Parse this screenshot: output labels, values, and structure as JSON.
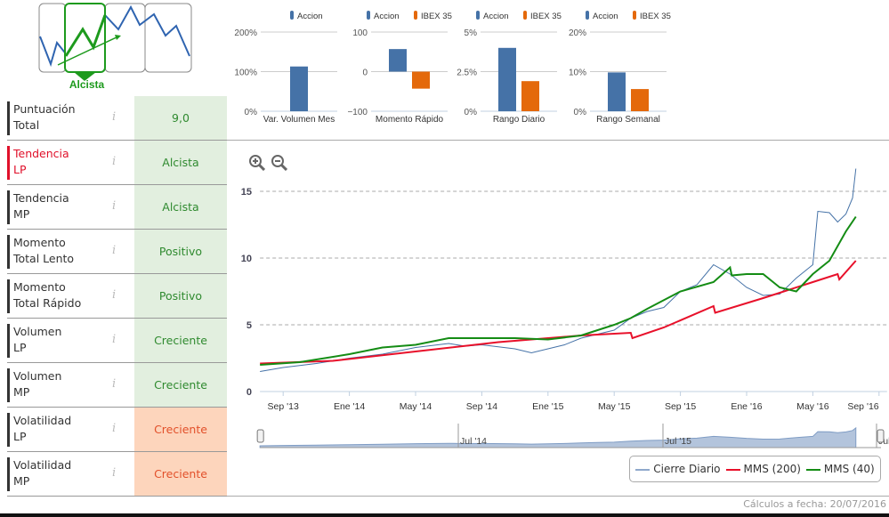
{
  "trend_logo": {
    "label": "Alcista"
  },
  "indicators": [
    {
      "label_l1": "Puntuación",
      "label_l2": "Total",
      "value": "9,0",
      "status": "positive",
      "highlight": false
    },
    {
      "label_l1": "Tendencia",
      "label_l2": "LP",
      "value": "Alcista",
      "status": "positive",
      "highlight": true
    },
    {
      "label_l1": "Tendencia",
      "label_l2": "MP",
      "value": "Alcista",
      "status": "positive",
      "highlight": false
    },
    {
      "label_l1": "Momento",
      "label_l2": "Total Lento",
      "value": "Positivo",
      "status": "positive",
      "highlight": false
    },
    {
      "label_l1": "Momento",
      "label_l2": "Total Rápido",
      "value": "Positivo",
      "status": "positive",
      "highlight": false
    },
    {
      "label_l1": "Volumen",
      "label_l2": "LP",
      "value": "Creciente",
      "status": "positive",
      "highlight": false
    },
    {
      "label_l1": "Volumen",
      "label_l2": "MP",
      "value": "Creciente",
      "status": "positive",
      "highlight": false
    },
    {
      "label_l1": "Volatilidad",
      "label_l2": "LP",
      "value": "Creciente",
      "status": "negative",
      "highlight": false
    },
    {
      "label_l1": "Volatilidad",
      "label_l2": "MP",
      "value": "Creciente",
      "status": "negative",
      "highlight": false
    }
  ],
  "info_glyph": "i",
  "colors": {
    "accion": "#4572a7",
    "ibex": "#e4690b",
    "cierre": "#4572a7",
    "mms200": "#e8102a",
    "mms40": "#148c14",
    "pos_bg": "#e2efdf",
    "neg_bg": "#fdd5bc"
  },
  "chart_data": [
    {
      "type": "bar",
      "title": "Var. Volumen Mes",
      "legend": [
        "Accion"
      ],
      "ticks": [
        "200%",
        "100%",
        "0%"
      ],
      "ylim": [
        0,
        200
      ],
      "series": [
        {
          "name": "Accion",
          "values": [
            113
          ]
        }
      ]
    },
    {
      "type": "bar",
      "title": "Momento Rápido",
      "legend": [
        "Accion",
        "IBEX 35"
      ],
      "ticks": [
        "100",
        "0",
        "−100"
      ],
      "ylim": [
        -100,
        100
      ],
      "series": [
        {
          "name": "Accion",
          "values": [
            57
          ]
        },
        {
          "name": "IBEX 35",
          "values": [
            -43
          ]
        }
      ]
    },
    {
      "type": "bar",
      "title": "Rango Diario",
      "legend": [
        "Accion",
        "IBEX 35"
      ],
      "ticks": [
        "5%",
        "2.5%",
        "0%"
      ],
      "ylim": [
        0,
        5
      ],
      "series": [
        {
          "name": "Accion",
          "values": [
            4.0
          ]
        },
        {
          "name": "IBEX 35",
          "values": [
            1.9
          ]
        }
      ]
    },
    {
      "type": "bar",
      "title": "Rango Semanal",
      "legend": [
        "Accion",
        "IBEX 35"
      ],
      "ticks": [
        "20%",
        "10%",
        "0%"
      ],
      "ylim": [
        0,
        20
      ],
      "series": [
        {
          "name": "Accion",
          "values": [
            9.8
          ]
        },
        {
          "name": "IBEX 35",
          "values": [
            5.6
          ]
        }
      ]
    },
    {
      "type": "line",
      "title": "",
      "x_unit": "months since Jul 2013",
      "xlim": [
        0.6,
        36.6
      ],
      "ylim": [
        0,
        17
      ],
      "y_ticks": [
        "0",
        "5",
        "10",
        "15"
      ],
      "y_tick_values": [
        0,
        5,
        10,
        15
      ],
      "x_ticks": [
        "Sep '13",
        "Ene '14",
        "May '14",
        "Sep '14",
        "Ene '15",
        "May '15",
        "Sep '15",
        "Ene '16",
        "May '16",
        "Sep '16"
      ],
      "x_tick_values": [
        2,
        6,
        10,
        14,
        18,
        22,
        26,
        30,
        34,
        38
      ],
      "navigator_labels": [
        "Jul '14",
        "Jul '15",
        "Jul"
      ],
      "navigator_values": [
        12,
        24,
        36
      ],
      "series": [
        {
          "name": "Cierre Diario",
          "points": [
            [
              0.6,
              1.5
            ],
            [
              2,
              1.8
            ],
            [
              4,
              2.1
            ],
            [
              6,
              2.5
            ],
            [
              8,
              2.8
            ],
            [
              10,
              3.3
            ],
            [
              12,
              3.6
            ],
            [
              13,
              3.4
            ],
            [
              14,
              3.5
            ],
            [
              16,
              3.2
            ],
            [
              17,
              2.9
            ],
            [
              18,
              3.2
            ],
            [
              19,
              3.5
            ],
            [
              20,
              4.0
            ],
            [
              21,
              4.3
            ],
            [
              22,
              4.6
            ],
            [
              23,
              5.5
            ],
            [
              24,
              6.0
            ],
            [
              25,
              6.3
            ],
            [
              26,
              7.5
            ],
            [
              27,
              8.0
            ],
            [
              28,
              9.5
            ],
            [
              29,
              8.8
            ],
            [
              30,
              7.8
            ],
            [
              31,
              7.2
            ],
            [
              32,
              7.3
            ],
            [
              33,
              8.5
            ],
            [
              34,
              9.5
            ],
            [
              34.3,
              13.5
            ],
            [
              35,
              13.4
            ],
            [
              35.5,
              12.7
            ],
            [
              36,
              13.3
            ],
            [
              36.4,
              14.5
            ],
            [
              36.6,
              16.7
            ]
          ]
        },
        {
          "name": "MMS (200)",
          "points": [
            [
              0.6,
              2.1
            ],
            [
              5,
              2.3
            ],
            [
              10,
              3.0
            ],
            [
              15,
              3.7
            ],
            [
              20,
              4.2
            ],
            [
              23,
              4.4
            ],
            [
              23.1,
              4.0
            ],
            [
              25,
              4.8
            ],
            [
              28,
              6.4
            ],
            [
              28.1,
              5.9
            ],
            [
              31,
              7.0
            ],
            [
              34,
              8.2
            ],
            [
              35.5,
              8.8
            ],
            [
              35.6,
              8.4
            ],
            [
              36.6,
              9.8
            ]
          ]
        },
        {
          "name": "MMS (40)",
          "points": [
            [
              0.6,
              2.0
            ],
            [
              3,
              2.2
            ],
            [
              6,
              2.8
            ],
            [
              8,
              3.3
            ],
            [
              10,
              3.5
            ],
            [
              12,
              4.0
            ],
            [
              14,
              4.0
            ],
            [
              16,
              4.0
            ],
            [
              18,
              3.9
            ],
            [
              20,
              4.2
            ],
            [
              22,
              5.0
            ],
            [
              23,
              5.5
            ],
            [
              24,
              6.2
            ],
            [
              26,
              7.5
            ],
            [
              28,
              8.2
            ],
            [
              29,
              9.3
            ],
            [
              29.1,
              8.7
            ],
            [
              30,
              8.8
            ],
            [
              31,
              8.8
            ],
            [
              32,
              7.8
            ],
            [
              33,
              7.5
            ],
            [
              34,
              8.8
            ],
            [
              35,
              9.8
            ],
            [
              36,
              12.0
            ],
            [
              36.6,
              13.1
            ]
          ]
        }
      ]
    }
  ],
  "legend": {
    "cierre": "Cierre Diario",
    "mms200": "MMS (200)",
    "mms40": "MMS (40)"
  },
  "zoom": {
    "in": "+",
    "out": "−"
  },
  "footer": "Cálculos a fecha: 20/07/2016"
}
